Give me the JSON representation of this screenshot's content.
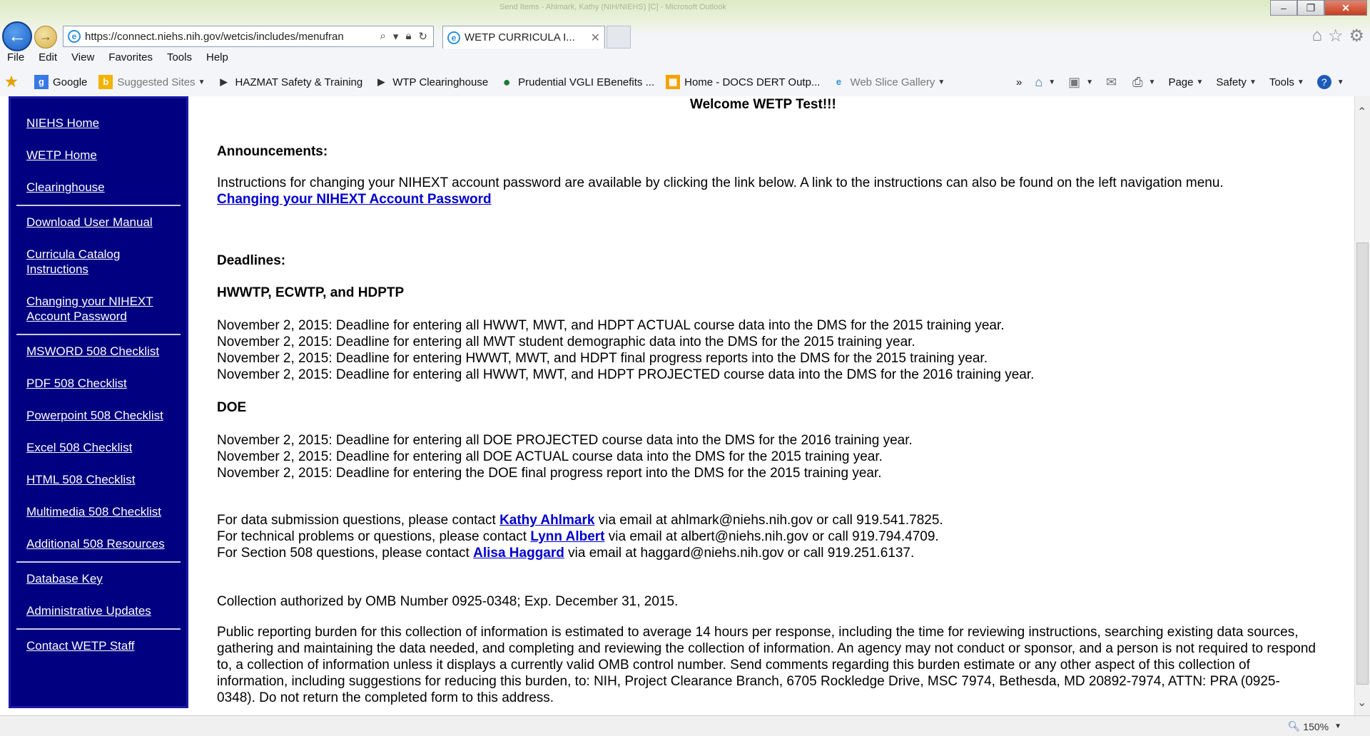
{
  "browser": {
    "url": "https://connect.niehs.nih.gov/wetcis/includes/menufran",
    "tab_title": "WETP CURRICULA I...",
    "window_blur_title": "Send Items - Ahlmark, Kathy (NIH/NIEHS) [C] - Microsoft Outlook",
    "menu": [
      "File",
      "Edit",
      "View",
      "Favorites",
      "Tools",
      "Help"
    ],
    "favorites": [
      {
        "label": "Google",
        "icon": "google-icon"
      },
      {
        "label": "Suggested Sites",
        "icon": "suggested-sites-icon"
      },
      {
        "label": "HAZMAT Safety & Training",
        "icon": "bookmark-icon"
      },
      {
        "label": "WTP Clearinghouse",
        "icon": "bookmark-icon"
      },
      {
        "label": "Prudential VGLI  EBenefits ...",
        "icon": "globe-icon"
      },
      {
        "label": "Home - DOCS DERT Outp...",
        "icon": "sharepoint-icon"
      },
      {
        "label": "Web Slice Gallery",
        "icon": "web-slice-icon"
      }
    ],
    "commands": [
      "Page",
      "Safety",
      "Tools"
    ],
    "zoom": "150%"
  },
  "sidebar": {
    "groups": [
      [
        "NIEHS Home",
        "WETP Home",
        "Clearinghouse"
      ],
      [
        "Download User Manual",
        "Curricula Catalog Instructions",
        "Changing your NIHEXT Account Password"
      ],
      [
        "MSWORD 508 Checklist",
        "PDF 508 Checklist",
        "Powerpoint 508 Checklist",
        "Excel 508 Checklist",
        "HTML 508 Checklist",
        "Multimedia 508 Checklist",
        "Additional 508 Resources"
      ],
      [
        "Database Key",
        "Administrative Updates"
      ],
      [
        "Contact WETP Staff"
      ]
    ]
  },
  "main": {
    "welcome": "Welcome WETP Test!!!",
    "announcements_heading": "Announcements:",
    "announcement_text": "Instructions for changing your NIHEXT account password are available by clicking the link below. A link to the instructions can also be found on the left navigation menu.",
    "announcement_link": "Changing your NIHEXT Account Password",
    "deadlines_heading": "Deadlines:",
    "group1_heading": "HWWTP, ECWTP, and HDPTP",
    "group1_items": [
      "November 2, 2015: Deadline for entering all HWWT, MWT, and HDPT ACTUAL course data into the DMS for the 2015 training year.",
      "November 2, 2015: Deadline for entering all MWT student demographic data into the DMS for the 2015 training year.",
      "November 2, 2015: Deadline for entering HWWT, MWT, and HDPT final progress reports into the DMS for the 2015 training year.",
      "November 2, 2015: Deadline for entering all HWWT, MWT, and HDPT PROJECTED course data into the DMS for the 2016 training year."
    ],
    "group2_heading": "DOE",
    "group2_items": [
      "November 2, 2015: Deadline for entering all DOE PROJECTED course data into the DMS for the 2016 training year.",
      "November 2, 2015: Deadline for entering all DOE ACTUAL course data into the DMS for the 2015 training year.",
      "November 2, 2015: Deadline for entering the DOE final progress report into the DMS for the 2015 training year."
    ],
    "contacts": [
      {
        "pre": "For data submission questions, please contact ",
        "name": "Kathy Ahlmark",
        "post": " via email at ahlmark@niehs.nih.gov or call 919.541.7825."
      },
      {
        "pre": "For technical problems or questions, please contact ",
        "name": "Lynn Albert",
        "post": " via email at albert@niehs.nih.gov or call 919.794.4709."
      },
      {
        "pre": "For Section 508 questions, please contact ",
        "name": "Alisa Haggard",
        "post": " via email at haggard@niehs.nih.gov or call 919.251.6137."
      }
    ],
    "omb": "Collection authorized by OMB Number 0925-0348; Exp. December 31, 2015.",
    "burden": "Public reporting burden for this collection of information is estimated to average 14 hours per response, including the time for reviewing instructions, searching existing data sources, gathering and maintaining the data needed, and completing and reviewing the collection of information. An agency may not conduct or sponsor, and a person is not required to respond to, a collection of information unless it displays a currently valid OMB control number. Send comments regarding this burden estimate or any other aspect of this collection of information, including suggestions for reducing this burden, to: NIH, Project Clearance Branch, 6705 Rockledge Drive, MSC 7974, Bethesda, MD 20892-7974, ATTN: PRA (0925- 0348). Do not return the completed form to this address."
  }
}
